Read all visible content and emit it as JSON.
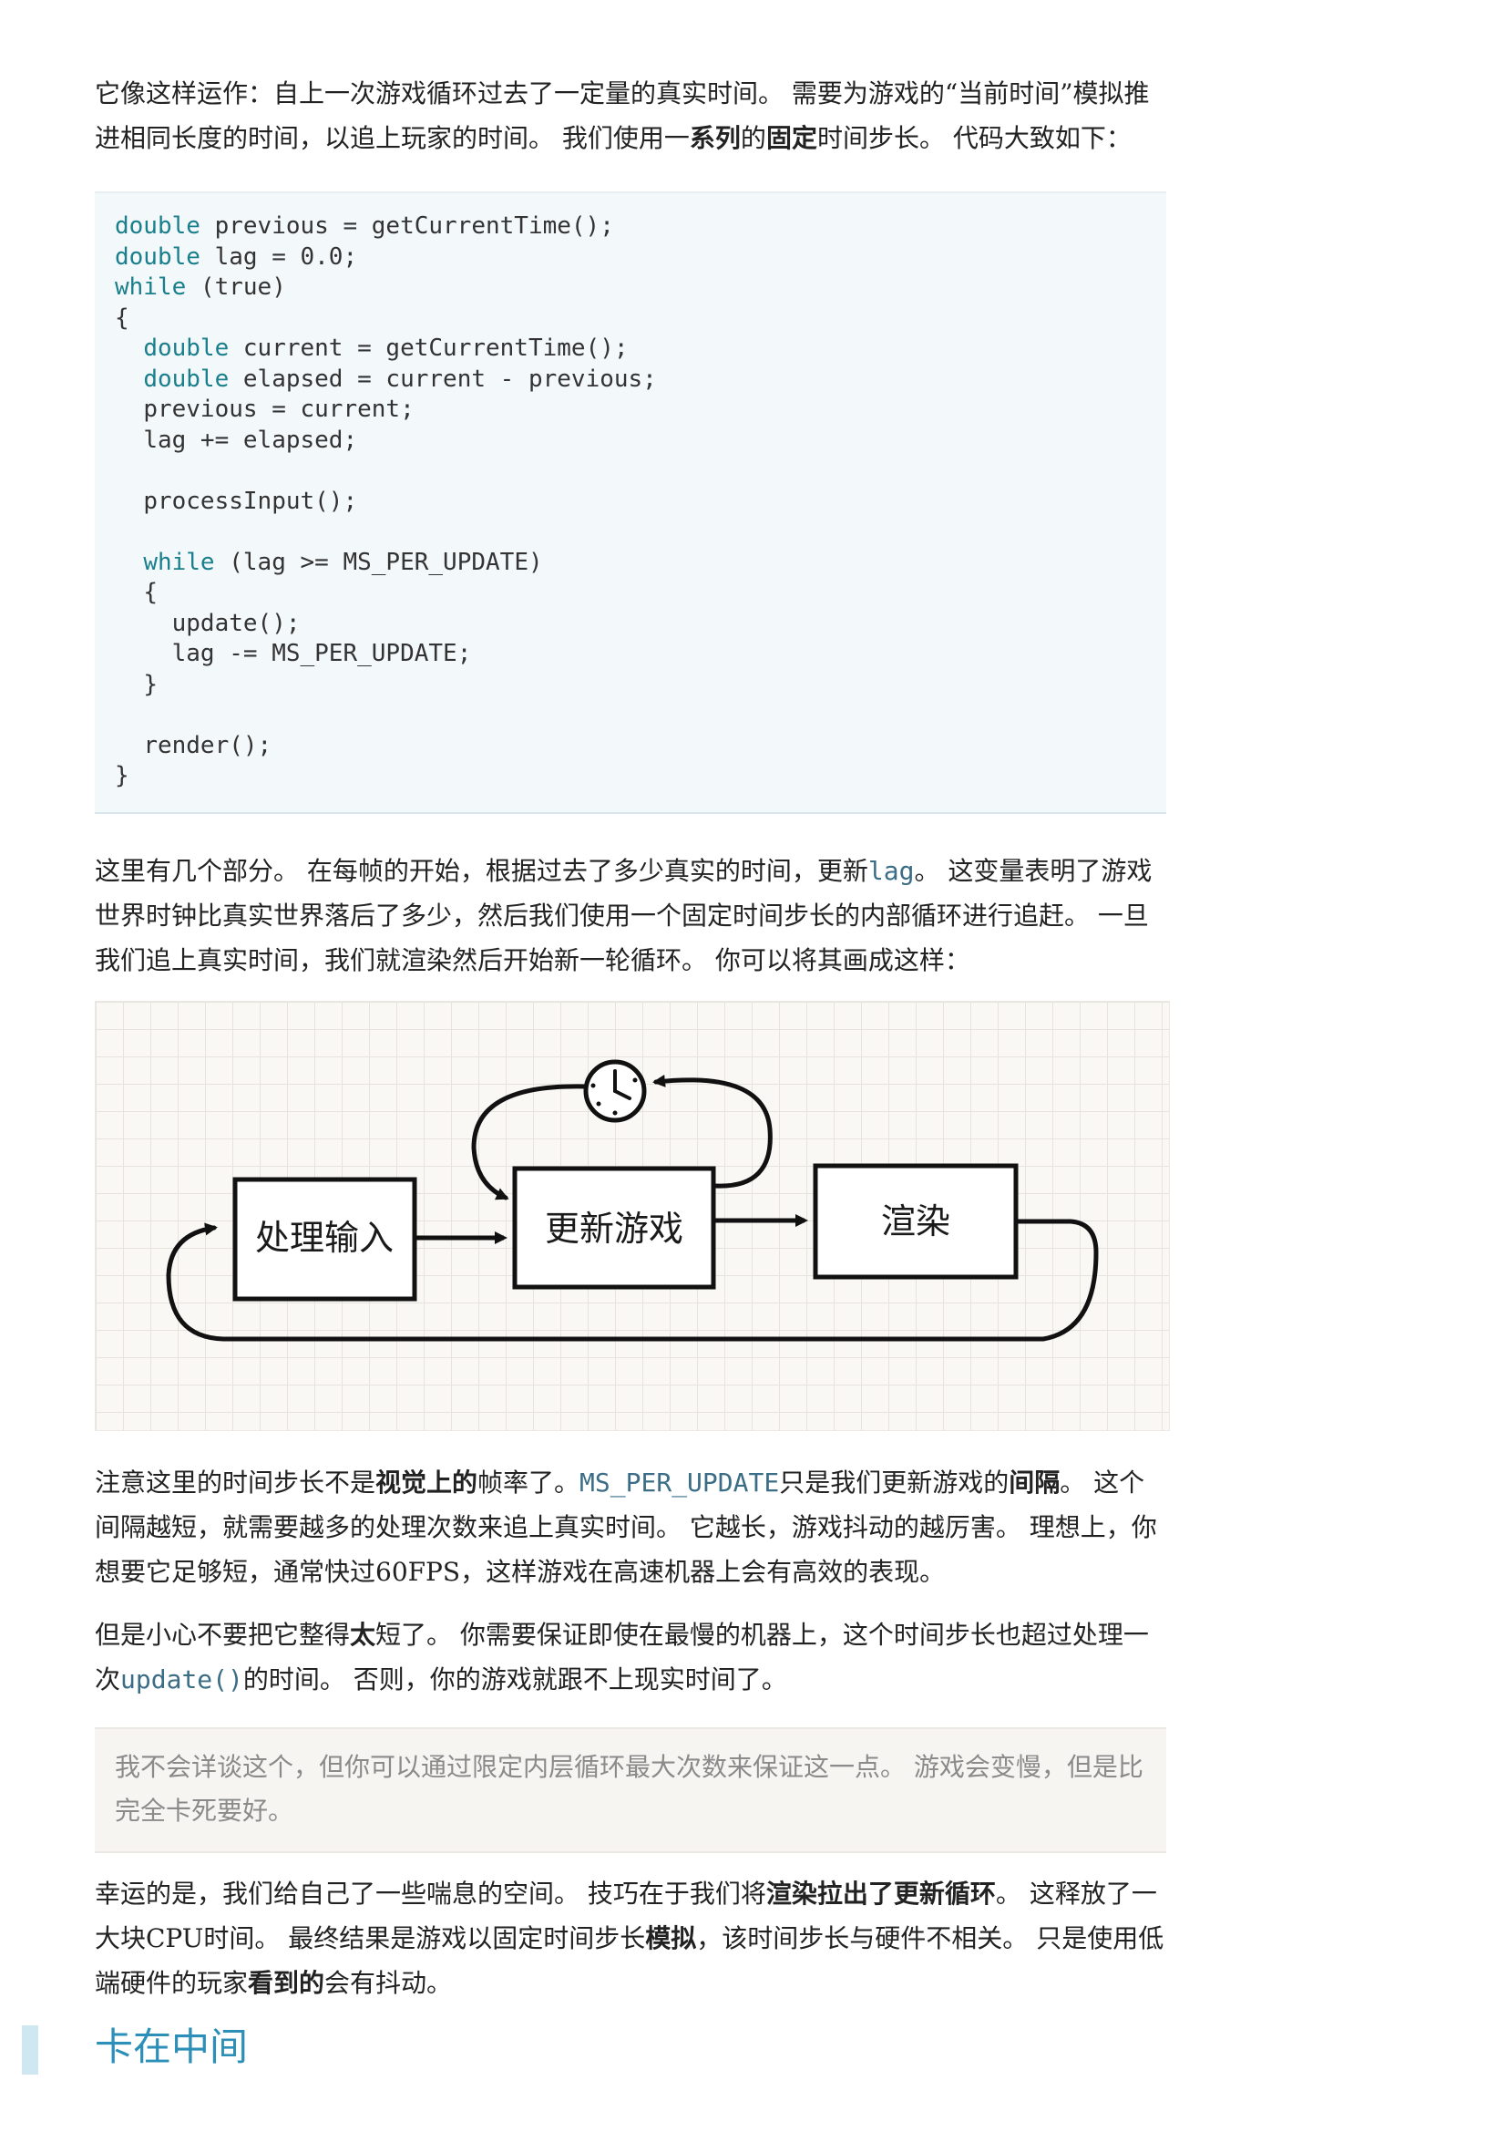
{
  "para1": {
    "t1": "它像这样运作：自上一次游戏循环过去了一定量的真实时间。 需要为游戏的“当前时间”模拟推进相同长度的时间，以追上玩家的时间。 我们使用一",
    "b1": "系列",
    "t2": "的",
    "b2": "固定",
    "t3": "时间步长。 代码大致如下："
  },
  "code_block": {
    "lines": [
      {
        "indent": "",
        "kw": "double",
        "rest": " previous = getCurrentTime();"
      },
      {
        "indent": "",
        "kw": "double",
        "rest": " lag = 0.0;"
      },
      {
        "indent": "",
        "kw": "while",
        "rest": " (true)"
      },
      {
        "indent": "",
        "kw": "",
        "rest": "{"
      },
      {
        "indent": "  ",
        "kw": "double",
        "rest": " current = getCurrentTime();"
      },
      {
        "indent": "  ",
        "kw": "double",
        "rest": " elapsed = current - previous;"
      },
      {
        "indent": "  ",
        "kw": "",
        "rest": "previous = current;"
      },
      {
        "indent": "  ",
        "kw": "",
        "rest": "lag += elapsed;"
      },
      {
        "indent": "",
        "kw": "",
        "rest": ""
      },
      {
        "indent": "  ",
        "kw": "",
        "rest": "processInput();"
      },
      {
        "indent": "",
        "kw": "",
        "rest": ""
      },
      {
        "indent": "  ",
        "kw": "while",
        "rest": " (lag >= MS_PER_UPDATE)"
      },
      {
        "indent": "  ",
        "kw": "",
        "rest": "{"
      },
      {
        "indent": "    ",
        "kw": "",
        "rest": "update();"
      },
      {
        "indent": "    ",
        "kw": "",
        "rest": "lag -= MS_PER_UPDATE;"
      },
      {
        "indent": "  ",
        "kw": "",
        "rest": "}"
      },
      {
        "indent": "",
        "kw": "",
        "rest": ""
      },
      {
        "indent": "  ",
        "kw": "",
        "rest": "render();"
      },
      {
        "indent": "",
        "kw": "",
        "rest": "}"
      }
    ]
  },
  "para2": {
    "t1": "这里有几个部分。 在每帧的开始，根据过去了多少真实的时间，更新",
    "code": "lag",
    "t2": "。 这变量表明了游戏世界时钟比真实世界落后了多少，然后我们使用一个固定时间步长的内部循环进行追赶。 一旦我们追上真实时间，我们就渲染然后开始新一轮循环。 你可以将其画成这样："
  },
  "figure": {
    "box_process_input": "处理输入",
    "box_update_game": "更新游戏",
    "box_render": "渲染"
  },
  "para3": {
    "t1": "注意这里的时间步长不是",
    "b1": "视觉上的",
    "t2": "帧率了。",
    "code": "MS_PER_UPDATE",
    "t3": "只是我们更新游戏的",
    "b2": "间隔",
    "t4": "。 这个间隔越短，就需要越多的处理次数来追上真实时间。 它越长，游戏抖动的越厉害。 理想上，你想要它足够短，通常快过60FPS，这样游戏在高速机器上会有高效的表现。"
  },
  "para4": {
    "t1": "但是小心不要把它整得",
    "b1": "太",
    "t2": "短了。 你需要保证即使在最慢的机器上，这个时间步长也超过处理一次",
    "code": "update()",
    "t3": "的时间。 否则，你的游戏就跟不上现实时间了。"
  },
  "aside": {
    "text": "我不会详谈这个，但你可以通过限定内层循环最大次数来保证这一点。 游戏会变慢，但是比完全卡死要好。"
  },
  "para5": {
    "t1": "幸运的是，我们给自己了一些喘息的空间。 技巧在于我们将",
    "b1": "渲染拉出了更新循环",
    "t2": "。 这释放了一大块CPU时间。 最终结果是游戏以固定时间步长",
    "b2": "模拟",
    "t3": "，该时间步长与硬件不相关。 只是使用低端硬件的玩家",
    "b3": "看到的",
    "t4": "会有抖动。"
  },
  "section_heading": "卡在中间",
  "colors": {
    "keyword": "#1a7f8c",
    "inline_code": "#3b6e86",
    "heading": "#2c8fb8",
    "aside_text": "#8a8a8a"
  }
}
